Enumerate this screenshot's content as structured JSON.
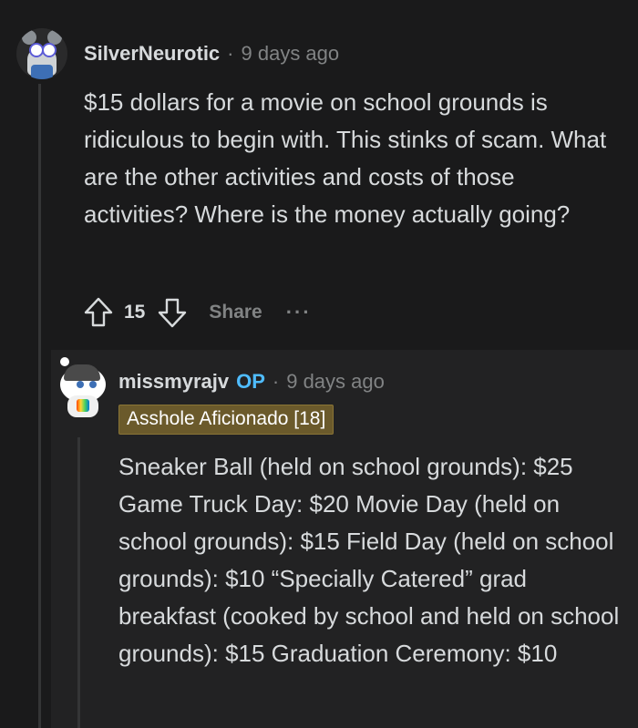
{
  "comment1": {
    "username": "SilverNeurotic",
    "separator": "·",
    "time": "9 days ago",
    "body": "$15 dollars for a movie on school grounds is ridiculous to begin with. This stinks of scam. What are the other activities and costs of those activities? Where is the money actually going?",
    "score": "15",
    "share_label": "Share",
    "more_label": "···",
    "avatar_icon": "koala-avatar-icon"
  },
  "comment2": {
    "username": "missmyrajv",
    "op_badge": "OP",
    "separator": "·",
    "time": "9 days ago",
    "flair": "Asshole Aficionado [18]",
    "body": "Sneaker Ball (held on school grounds): $25 Game Truck Day: $20 Movie Day (held on school grounds): $15 Field Day (held on school grounds): $10 “Specially Catered” grad breakfast (cooked by school and held on school grounds): $15 Graduation Ceremony: $10",
    "avatar_icon": "snoo-avatar-icon"
  },
  "colors": {
    "background": "#1a1a1b",
    "reply_background": "#222223",
    "op_blue": "#4fbcff",
    "flair_bg": "#6b5a2b",
    "muted": "#818384"
  }
}
